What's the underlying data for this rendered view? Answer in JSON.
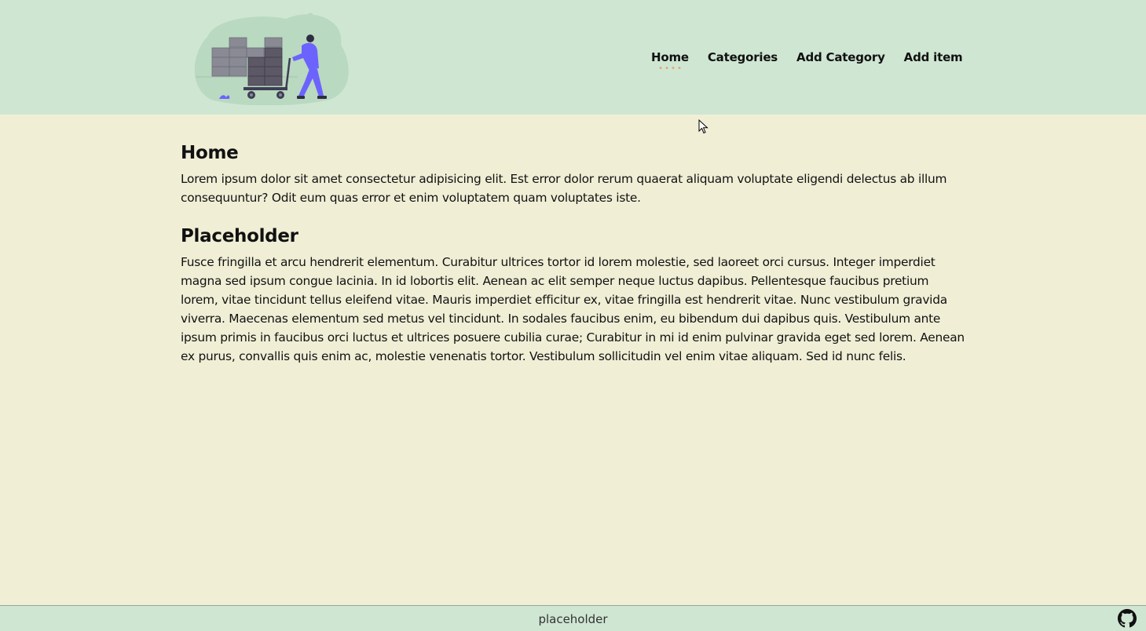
{
  "nav": {
    "items": [
      {
        "label": "Home",
        "active": true
      },
      {
        "label": "Categories"
      },
      {
        "label": "Add Category"
      },
      {
        "label": "Add item"
      }
    ]
  },
  "main": {
    "sections": [
      {
        "title": "Home",
        "body": "Lorem ipsum dolor sit amet consectetur adipisicing elit. Est error dolor rerum quaerat aliquam voluptate eligendi delectus ab illum consequuntur? Odit eum quas error et enim voluptatem quam voluptates iste."
      },
      {
        "title": "Placeholder",
        "body": "Fusce fringilla et arcu hendrerit elementum. Curabitur ultrices tortor id lorem molestie, sed laoreet orci cursus. Integer imperdiet magna sed ipsum congue lacinia. In id lobortis elit. Aenean ac elit semper neque luctus dapibus. Pellentesque faucibus pretium lorem, vitae tincidunt tellus eleifend vitae. Mauris imperdiet efficitur ex, vitae fringilla est hendrerit vitae. Nunc vestibulum gravida viverra. Maecenas elementum sed metus vel tincidunt. In sodales faucibus enim, eu bibendum dui dapibus quis. Vestibulum ante ipsum primis in faucibus orci luctus et ultrices posuere cubilia curae; Curabitur in mi id enim pulvinar gravida eget sed lorem. Aenean ex purus, convallis quis enim ac, molestie venenatis tortor. Vestibulum sollicitudin vel enim vitae aliquam. Sed id nunc felis."
      }
    ]
  },
  "footer": {
    "text": "placeholder",
    "icon": "github-icon"
  },
  "colors": {
    "header_bg": "#cfe6d3",
    "page_bg": "#f0efd6",
    "active_indicator": "#e4a86a",
    "illustration_accent": "#6c63ff"
  }
}
